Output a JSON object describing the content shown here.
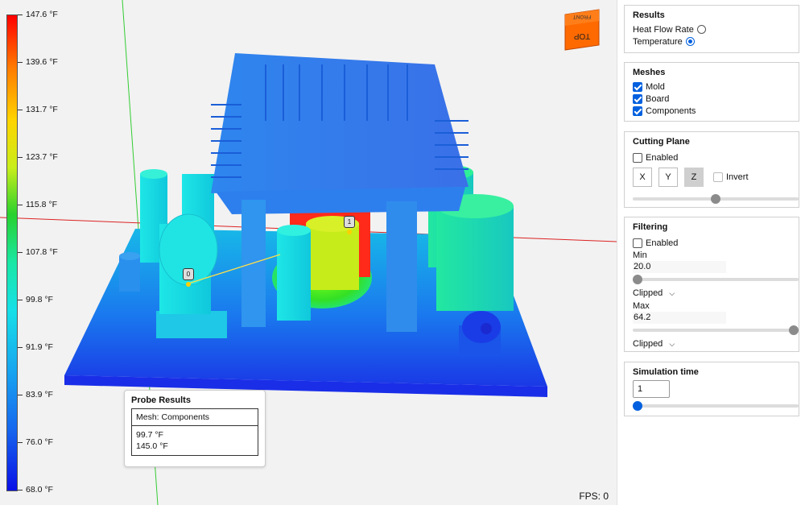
{
  "legend": {
    "labels": [
      "147.6 °F",
      "139.6 °F",
      "131.7 °F",
      "123.7 °F",
      "115.8 °F",
      "107.8 °F",
      "99.8 °F",
      "91.9 °F",
      "83.9 °F",
      "76.0 °F",
      "68.0 °F"
    ]
  },
  "viewport": {
    "fps_label": "FPS: 0",
    "view_cube": {
      "top_label": "TOP",
      "front_label": "FRONT"
    },
    "probes": [
      {
        "label": "0"
      },
      {
        "label": "1"
      }
    ]
  },
  "probe_results": {
    "title": "Probe Results",
    "mesh_label": "Mesh: Components",
    "values": [
      "99.7 °F",
      "145.0 °F"
    ]
  },
  "results": {
    "title": "Results",
    "options": [
      {
        "label": "Heat Flow Rate",
        "selected": false
      },
      {
        "label": "Temperature",
        "selected": true
      }
    ]
  },
  "meshes": {
    "title": "Meshes",
    "items": [
      {
        "label": "Mold",
        "checked": true
      },
      {
        "label": "Board",
        "checked": true
      },
      {
        "label": "Components",
        "checked": true
      }
    ]
  },
  "cutting_plane": {
    "title": "Cutting Plane",
    "enabled_label": "Enabled",
    "enabled": false,
    "axes": [
      "X",
      "Y",
      "Z"
    ],
    "active_axis": "Z",
    "invert_label": "Invert",
    "position_fraction": 0.5
  },
  "filtering": {
    "title": "Filtering",
    "enabled_label": "Enabled",
    "enabled": false,
    "min_label": "Min",
    "min_value": "20.0",
    "min_mode": "Clipped",
    "max_label": "Max",
    "max_value": "64.2",
    "max_mode": "Clipped",
    "min_fraction": 0.0,
    "max_fraction": 1.0
  },
  "simulation_time": {
    "title": "Simulation time",
    "value": "1",
    "fraction": 0.0
  },
  "colors": {
    "viewport_bg": "#f2f2f2",
    "accent": "#0060df",
    "hot": "#ff2a1a",
    "cold": "#1a2ee8"
  }
}
